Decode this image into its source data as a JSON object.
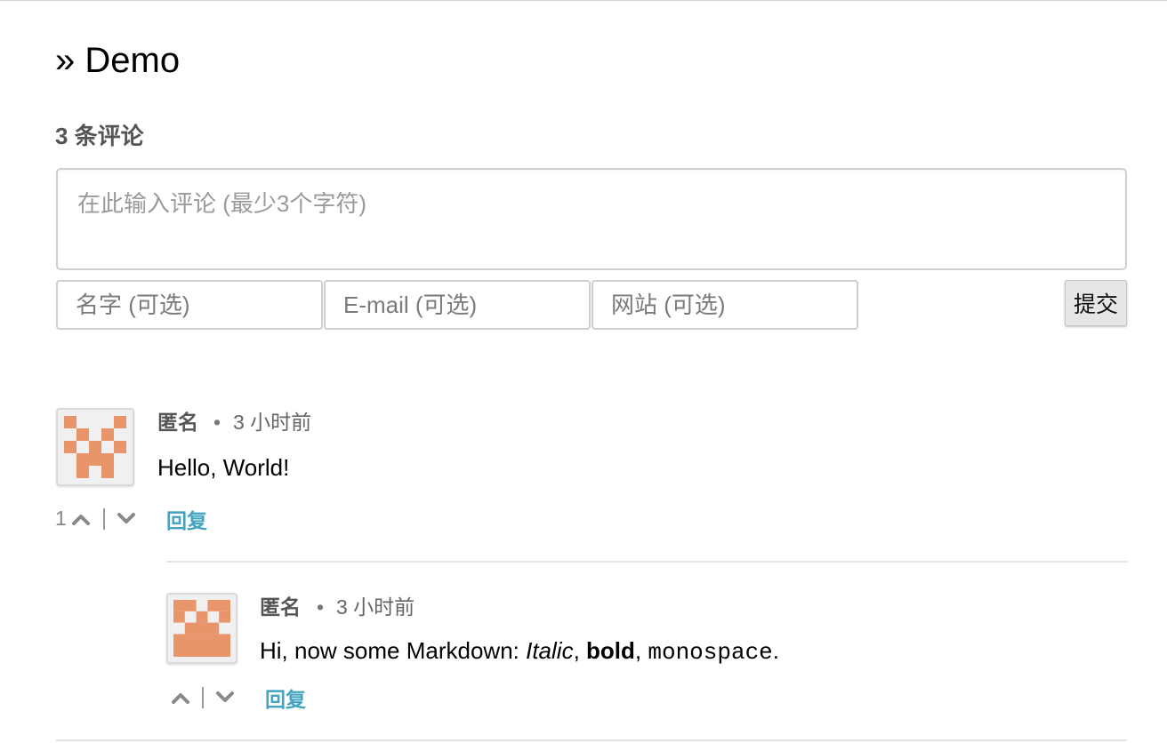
{
  "page": {
    "title": "» Demo"
  },
  "comments_header": {
    "count_label": "3 条评论"
  },
  "form": {
    "textarea_placeholder": "在此输入评论 (最少3个字符)",
    "name_placeholder": "名字 (可选)",
    "email_placeholder": "E-mail (可选)",
    "website_placeholder": "网站 (可选)",
    "submit_label": "提交"
  },
  "comments": [
    {
      "author": "匿名",
      "separator": "•",
      "time": "3 小时前",
      "text": "Hello, World!",
      "vote_count": "1",
      "reply_label": "回复",
      "avatar_color": "#e8956b"
    },
    {
      "author": "匿名",
      "separator": "•",
      "time": "3 小时前",
      "text_prefix": "Hi, now some Markdown: ",
      "text_italic": "Italic",
      "text_comma1": ", ",
      "text_bold": "bold",
      "text_comma2": ", ",
      "text_code": "monospace",
      "text_end": ".",
      "vote_count": "",
      "reply_label": "回复",
      "avatar_color": "#e8956b"
    }
  ],
  "icons": {
    "upvote": "chevron-up-icon",
    "downvote": "chevron-down-icon"
  }
}
